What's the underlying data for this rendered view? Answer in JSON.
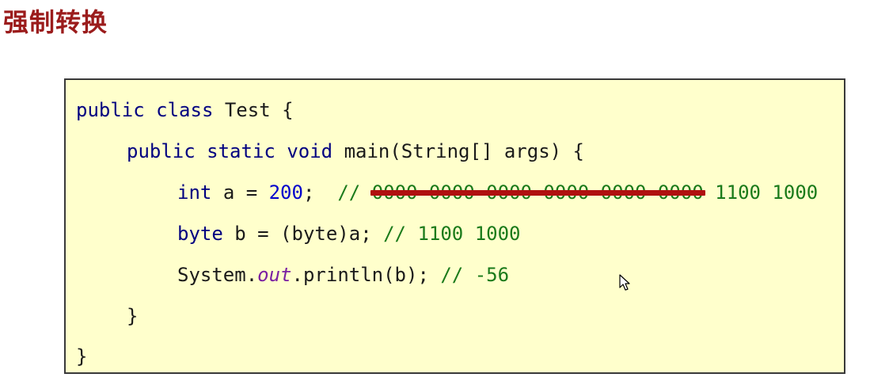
{
  "title": "强制转换",
  "code": {
    "line1": {
      "kw1": "public",
      "kw2": "class",
      "name": "Test {"
    },
    "line2": {
      "kw1": "public",
      "kw2": "static",
      "kw3": "void",
      "rest": "main(String[] args) {"
    },
    "line3": {
      "kw": "int",
      "assign": "a = ",
      "num": "200",
      "semi": ";",
      "comment_prefix": "//",
      "struck": "0000 0000 0000 0000 0000 0000",
      "comment_tail": "1100 1000"
    },
    "line4": {
      "kw": "byte",
      "assign": "b = (byte)a;",
      "comment": "// 1100 1000"
    },
    "line5": {
      "pre": "System.",
      "italic": "out",
      "post": ".println(b);",
      "comment": "// -56"
    },
    "line6": {
      "brace": "}"
    },
    "line7": {
      "brace": "}"
    }
  },
  "colors": {
    "title": "#9b1c1c",
    "box_bg": "#ffffcc",
    "keyword": "#000080",
    "number": "#0000cc",
    "comment": "#1a7a1a",
    "strike": "#b01010"
  },
  "icons": {
    "cursor": "mouse-pointer-icon"
  }
}
